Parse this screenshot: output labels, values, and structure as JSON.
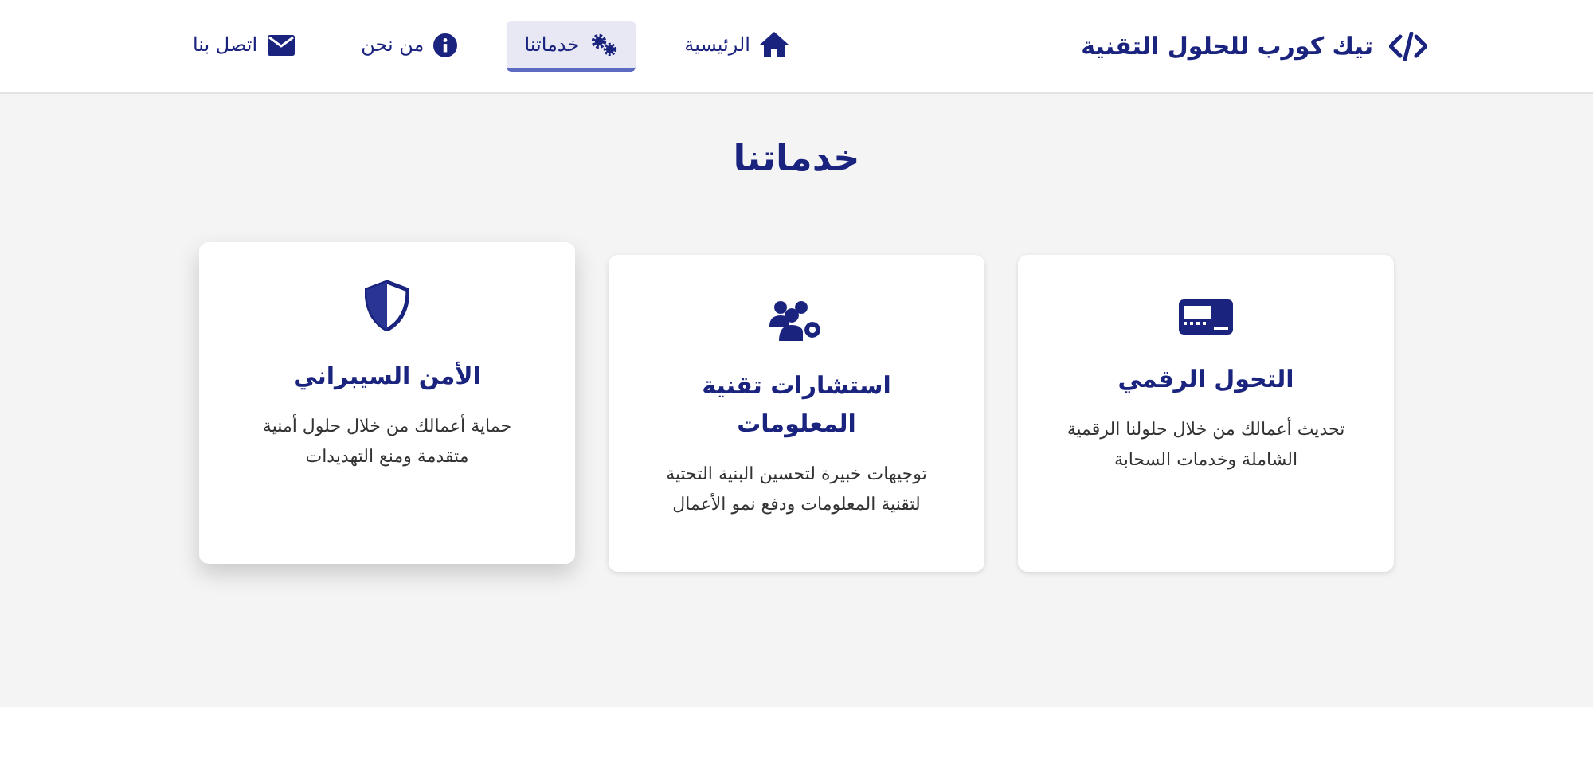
{
  "brand": {
    "name": "تيك كورب للحلول التقنية"
  },
  "nav": [
    {
      "label": "الرئيسية",
      "kind": "home",
      "selected": false
    },
    {
      "label": "خدماتنا",
      "kind": "gears",
      "selected": true
    },
    {
      "label": "من نحن",
      "kind": "info",
      "selected": false
    },
    {
      "label": "اتصل بنا",
      "kind": "mail",
      "selected": false
    }
  ],
  "section": {
    "title": "خدماتنا",
    "cards": [
      {
        "kind": "card",
        "title": "التحول الرقمي",
        "text": "تحديث أعمالك من خلال حلولنا الرقمية الشاملة وخدمات السحابة",
        "raised": false
      },
      {
        "kind": "users",
        "title": "استشارات تقنية المعلومات",
        "text": "توجيهات خبيرة لتحسين البنية التحتية لتقنية المعلومات ودفع نمو الأعمال",
        "raised": false
      },
      {
        "kind": "shield",
        "title": "الأمن السيبراني",
        "text": "حماية أعمالك من خلال حلول أمنية متقدمة ومنع التهديدات",
        "raised": true
      }
    ]
  }
}
